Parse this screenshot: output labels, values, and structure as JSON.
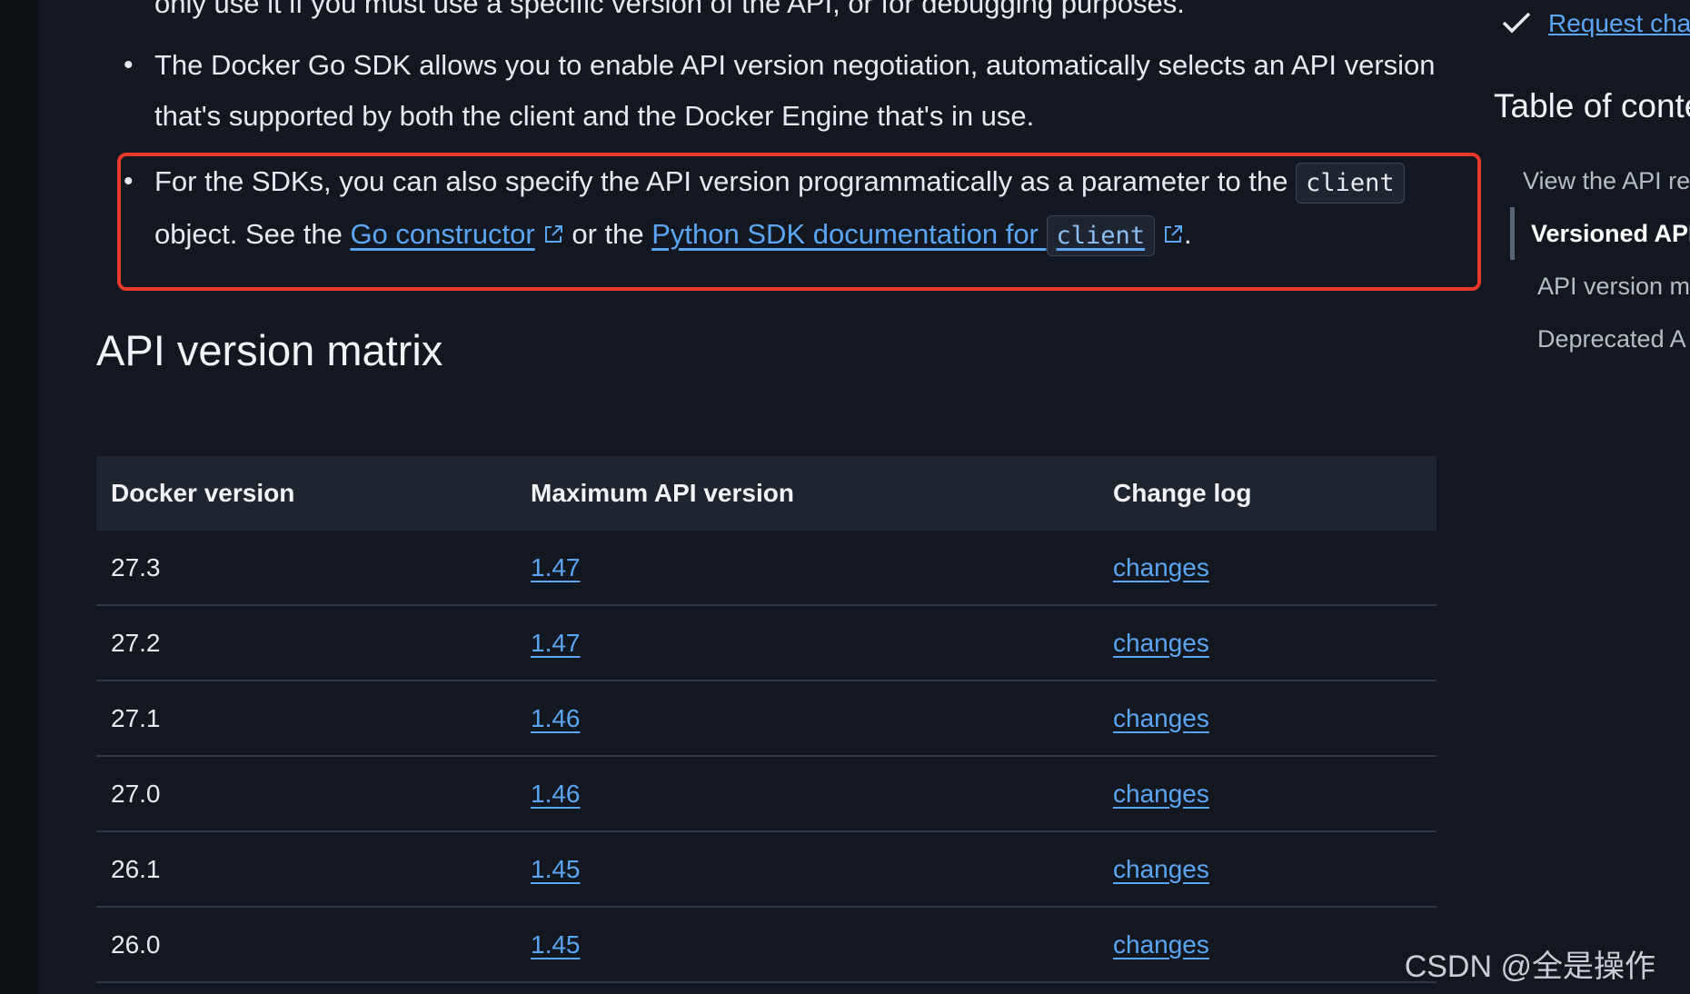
{
  "main": {
    "cutoff_line": "only use it if you must use a specific version of the API, or for debugging purposes.",
    "bullet_go_sdk": "The Docker Go SDK allows you to enable API version negotiation, automatically selects an API version that's supported by both the client and the Docker Engine that's in use.",
    "bullet_sdks": {
      "text_before_code": "For the SDKs, you can also specify the API version programmatically as a parameter to the ",
      "code_client": "client",
      "text_object_see": " object. See the ",
      "go_link": "Go constructor",
      "text_or_the": " or the ",
      "python_link": "Python SDK documentation for ",
      "python_code": "client",
      "text_end": "."
    },
    "heading": "API version matrix",
    "table": {
      "columns": [
        "Docker version",
        "Maximum API version",
        "Change log"
      ],
      "rows": [
        {
          "docker": "27.3",
          "api": "1.47",
          "log": "changes"
        },
        {
          "docker": "27.2",
          "api": "1.47",
          "log": "changes"
        },
        {
          "docker": "27.1",
          "api": "1.46",
          "log": "changes"
        },
        {
          "docker": "27.0",
          "api": "1.46",
          "log": "changes"
        },
        {
          "docker": "26.1",
          "api": "1.45",
          "log": "changes"
        },
        {
          "docker": "26.0",
          "api": "1.45",
          "log": "changes"
        }
      ]
    }
  },
  "sidebar": {
    "request_link": "Request cha",
    "toc_title": "Table of conte",
    "toc_items": [
      "View the API re",
      "Versioned API",
      "API version m",
      "Deprecated A"
    ]
  },
  "watermark": "CSDN @全是操作",
  "colors": {
    "background": "#131820",
    "link": "#5ba5f5",
    "highlight_border": "#e8392c"
  },
  "icons": {
    "external": "external-link-icon",
    "check": "check-icon"
  }
}
